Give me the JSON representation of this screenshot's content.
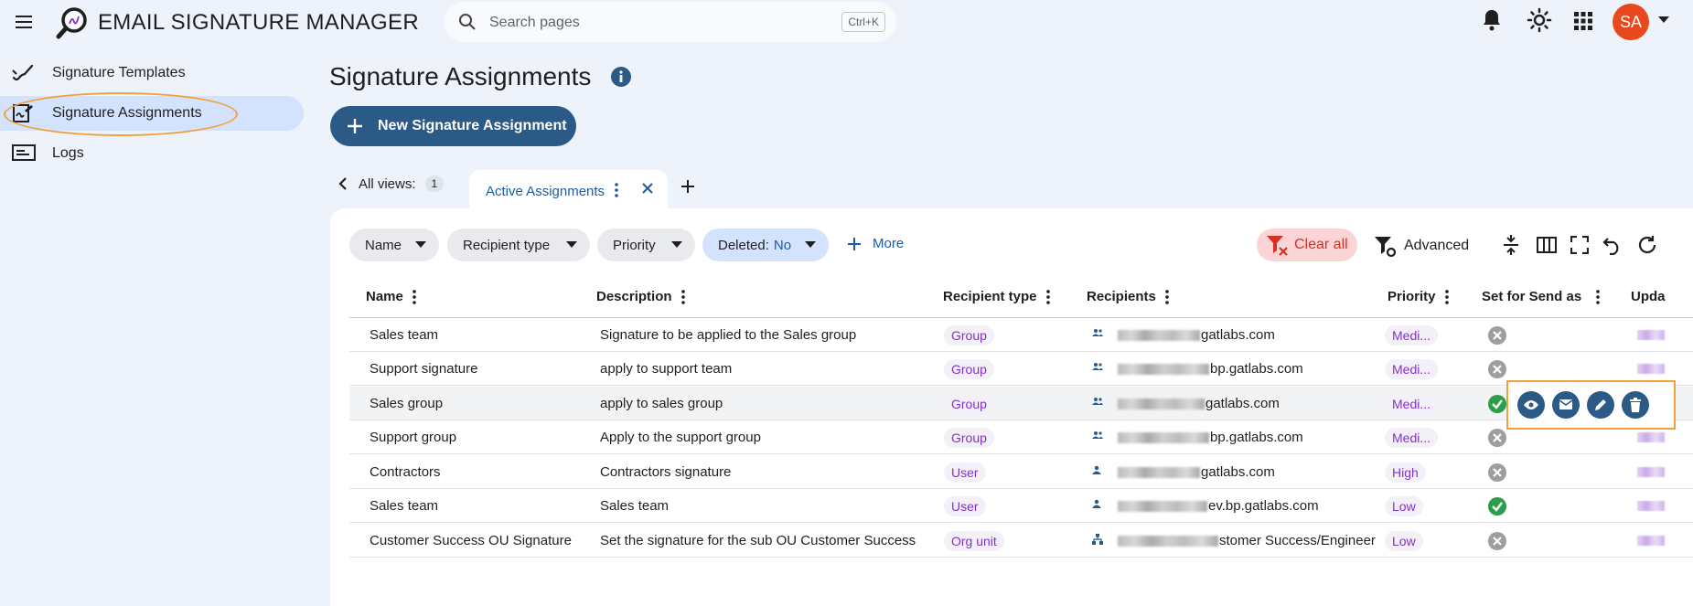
{
  "app": {
    "title": "EMAIL SIGNATURE MANAGER",
    "search_placeholder": "Search pages",
    "search_shortcut": "Ctrl+K",
    "avatar_initials": "SA"
  },
  "sidebar": {
    "items": [
      {
        "label": "Signature Templates",
        "icon": "brush-icon"
      },
      {
        "label": "Signature Assignments",
        "icon": "signature-doc-icon",
        "active": true
      },
      {
        "label": "Logs",
        "icon": "logs-icon"
      }
    ]
  },
  "page": {
    "title": "Signature Assignments",
    "new_button": "New Signature Assignment"
  },
  "views": {
    "all_views_label": "All views:",
    "all_views_count": "1",
    "active_tab": "Active Assignments"
  },
  "filters": {
    "chips": [
      {
        "label": "Name"
      },
      {
        "label": "Recipient type"
      },
      {
        "label": "Priority"
      },
      {
        "label": "Deleted:",
        "value": "No"
      }
    ],
    "more": "More",
    "clear_all": "Clear all",
    "advanced": "Advanced"
  },
  "table": {
    "columns": [
      "Name",
      "Description",
      "Recipient type",
      "Recipients",
      "Priority",
      "Set for Send as",
      "Upda"
    ],
    "rows": [
      {
        "name": "Sales team",
        "description": "Signature to be applied to the Sales group",
        "type": "Group",
        "recipients": "gatlabs.com",
        "priority": "Medi...",
        "send_as": false
      },
      {
        "name": "Support signature",
        "description": "apply to support team",
        "type": "Group",
        "recipients": "bp.gatlabs.com",
        "priority": "Medi...",
        "send_as": false
      },
      {
        "name": "Sales group",
        "description": "apply to sales group",
        "type": "Group",
        "recipients": "gatlabs.com",
        "priority": "Medi...",
        "send_as": true
      },
      {
        "name": "Support group",
        "description": "Apply to the support group",
        "type": "Group",
        "recipients": "bp.gatlabs.com",
        "priority": "Medi...",
        "send_as": false
      },
      {
        "name": "Contractors",
        "description": "Contractors signature",
        "type": "User",
        "recipients": "gatlabs.com",
        "priority": "High",
        "send_as": false
      },
      {
        "name": "Sales team",
        "description": "Sales team",
        "type": "User",
        "recipients": "ev.bp.gatlabs.com",
        "priority": "Low",
        "send_as": true
      },
      {
        "name": "Customer Success OU Signature",
        "description": "Set the signature for the sub OU Customer Success",
        "type": "Org unit",
        "recipients": "stomer Success/Engineer",
        "priority": "Low",
        "send_as": false
      }
    ]
  },
  "row_actions": [
    "view-icon",
    "email-icon",
    "edit-icon",
    "delete-icon"
  ],
  "colors": {
    "accent": "#2b5a86",
    "highlight": "#f2a03d",
    "badge_text": "#8430ce"
  }
}
